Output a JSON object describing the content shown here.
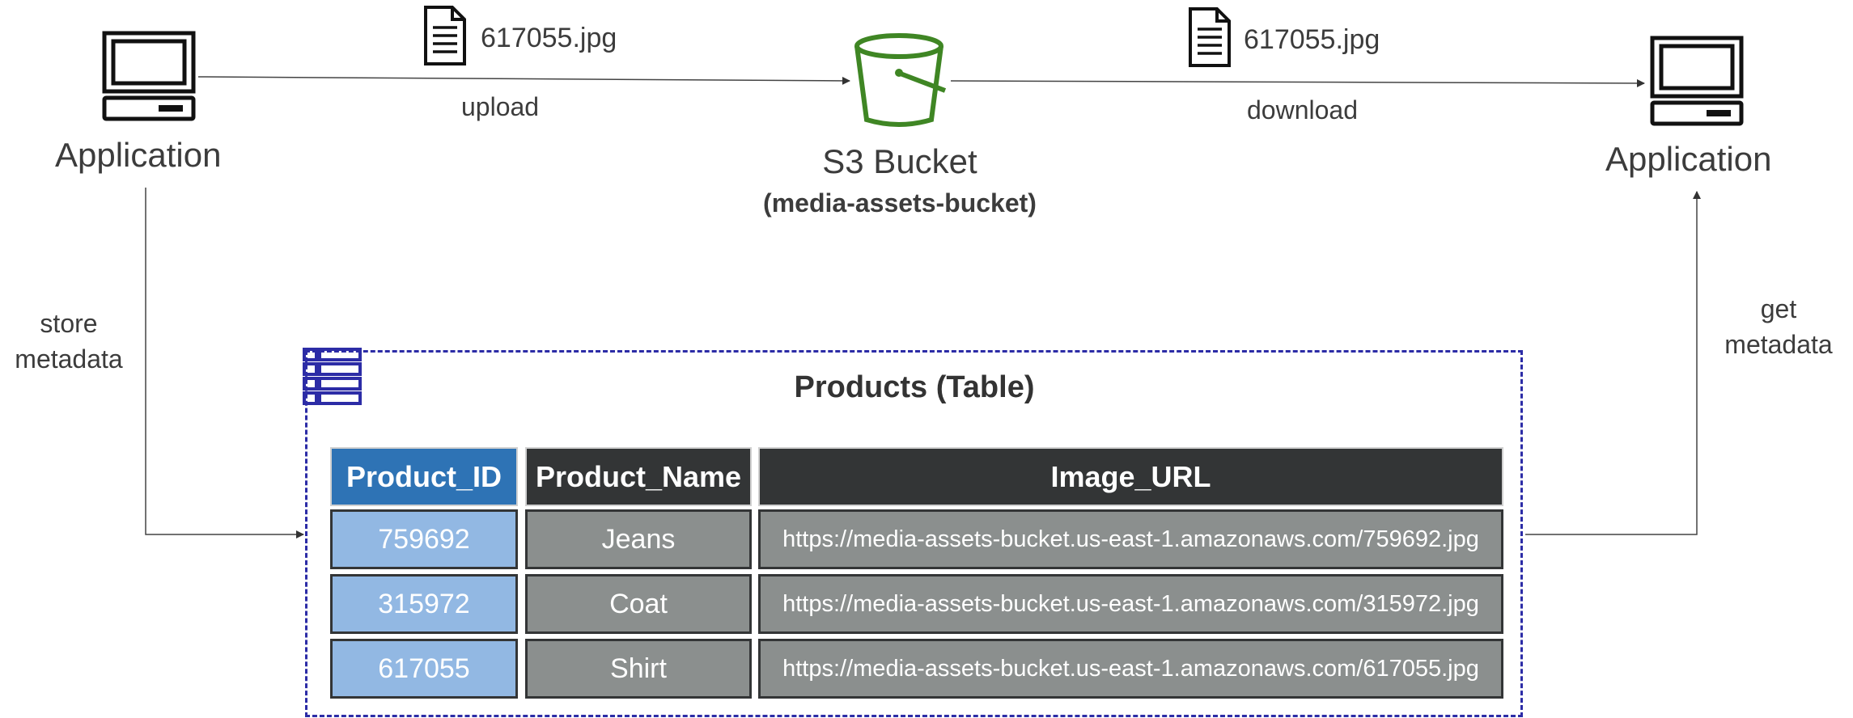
{
  "left_app": {
    "label": "Application"
  },
  "right_app": {
    "label": "Application"
  },
  "upload": {
    "file_name": "617055.jpg",
    "label": "upload"
  },
  "download": {
    "file_name": "617055.jpg",
    "label": "download"
  },
  "bucket": {
    "title": "S3 Bucket",
    "name": "(media-assets-bucket)"
  },
  "store_metadata": {
    "line1": "store",
    "line2": "metadata"
  },
  "get_metadata": {
    "line1": "get",
    "line2": "metadata"
  },
  "table": {
    "title": "Products (Table)",
    "headers": [
      "Product_ID",
      "Product_Name",
      "Image_URL"
    ],
    "rows": [
      [
        "759692",
        "Jeans",
        "https://media-assets-bucket.us-east-1.amazonaws.com/759692.jpg"
      ],
      [
        "315972",
        "Coat",
        "https://media-assets-bucket.us-east-1.amazonaws.com/315972.jpg"
      ],
      [
        "617055",
        "Shirt",
        "https://media-assets-bucket.us-east-1.amazonaws.com/617055.jpg"
      ]
    ]
  },
  "colors": {
    "bucket_green": "#3f8624",
    "table_border": "#2c2ca6",
    "id_header": "#2e73b5",
    "id_cell": "#92b8e3",
    "dark_header": "#333536",
    "gray_cell": "#8b8f8e"
  },
  "icons": [
    "computer-icon",
    "document-icon",
    "s3-bucket-icon",
    "table-icon"
  ]
}
